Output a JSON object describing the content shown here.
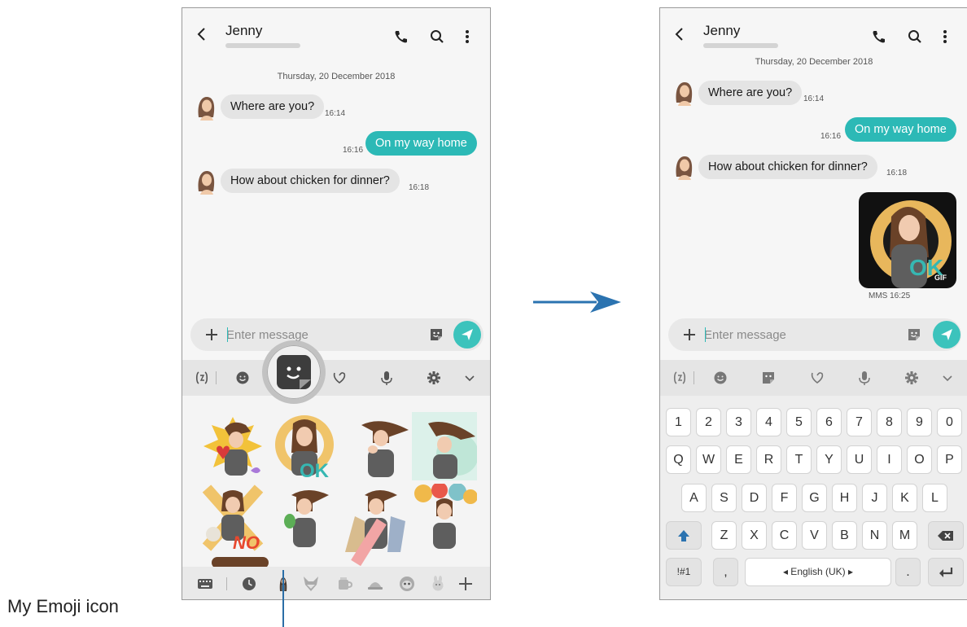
{
  "left_screen": {
    "contact_name": "Jenny",
    "date": "Thursday, 20 December 2018",
    "messages": [
      {
        "dir": "in",
        "text": "Where are you?",
        "time": "16:14"
      },
      {
        "dir": "out",
        "text": "On my way home",
        "time": "16:16"
      },
      {
        "dir": "in",
        "text": "How about chicken for dinner?",
        "time": "16:18"
      }
    ],
    "input_placeholder": "Enter message"
  },
  "right_screen": {
    "contact_name": "Jenny",
    "date": "Thursday, 20 December 2018",
    "messages": [
      {
        "dir": "in",
        "text": "Where are you?",
        "time": "16:14"
      },
      {
        "dir": "out",
        "text": "On my way home",
        "time": "16:16"
      },
      {
        "dir": "in",
        "text": "How about chicken for dinner?",
        "time": "16:18"
      }
    ],
    "mms_badge": "GIF",
    "mms_sticker_text": "OK",
    "mms_meta": "MMS 16:25",
    "input_placeholder": "Enter message"
  },
  "sticker_texts": {
    "ok": "OK",
    "no": "NO"
  },
  "keyboard": {
    "row_numbers": [
      "1",
      "2",
      "3",
      "4",
      "5",
      "6",
      "7",
      "8",
      "9",
      "0"
    ],
    "row_qwerty": [
      "Q",
      "W",
      "E",
      "R",
      "T",
      "Y",
      "U",
      "I",
      "O",
      "P"
    ],
    "row_asdf": [
      "A",
      "S",
      "D",
      "F",
      "G",
      "H",
      "J",
      "K",
      "L"
    ],
    "row_zxcv": [
      "Z",
      "X",
      "C",
      "V",
      "B",
      "N",
      "M"
    ],
    "symbols_key": "!#1",
    "comma_key": ",",
    "period_key": ".",
    "space_label": "◂ English (UK) ▸"
  },
  "callout": {
    "label": "My Emoji icon"
  },
  "colors": {
    "accent": "#2cb9b6",
    "callout_line": "#2b6ea6",
    "arrow": "#2b73b0"
  }
}
